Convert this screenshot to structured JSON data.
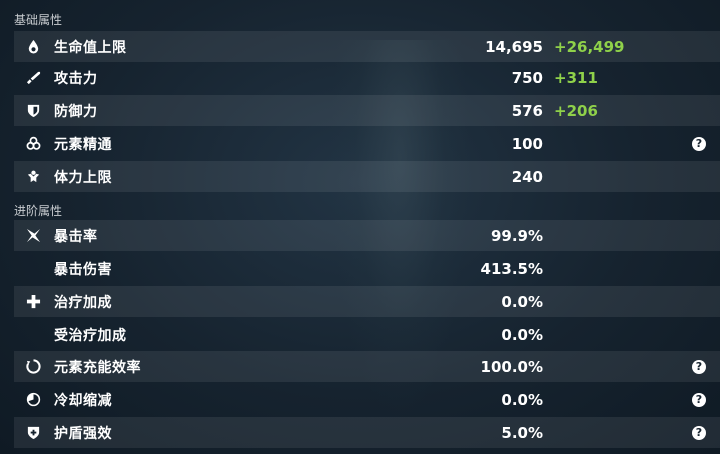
{
  "sections": {
    "basic_title": "基础属性",
    "advanced_title": "进阶属性"
  },
  "basic_stats": [
    {
      "icon": "hp-drop-icon",
      "label": "生命值上限",
      "value": "14,695",
      "bonus": "+26,499",
      "help": false
    },
    {
      "icon": "sword-icon",
      "label": "攻击力",
      "value": "750",
      "bonus": "+311",
      "help": false
    },
    {
      "icon": "shield-icon",
      "label": "防御力",
      "value": "576",
      "bonus": "+206",
      "help": false
    },
    {
      "icon": "elemental-mastery-icon",
      "label": "元素精通",
      "value": "100",
      "bonus": "",
      "help": true
    },
    {
      "icon": "stamina-icon",
      "label": "体力上限",
      "value": "240",
      "bonus": "",
      "help": false
    }
  ],
  "advanced_stats": [
    {
      "icon": "crit-icon",
      "label": "暴击率",
      "value": "99.9%",
      "help": false
    },
    {
      "icon": "",
      "label": "暴击伤害",
      "value": "413.5%",
      "help": false
    },
    {
      "icon": "healing-cross-icon",
      "label": "治疗加成",
      "value": "0.0%",
      "help": false
    },
    {
      "icon": "",
      "label": "受治疗加成",
      "value": "0.0%",
      "help": false
    },
    {
      "icon": "energy-recharge-icon",
      "label": "元素充能效率",
      "value": "100.0%",
      "help": true
    },
    {
      "icon": "cooldown-icon",
      "label": "冷却缩减",
      "value": "0.0%",
      "help": true
    },
    {
      "icon": "shield-strength-icon",
      "label": "护盾强效",
      "value": "5.0%",
      "help": true
    }
  ],
  "help_glyph": "?",
  "colors": {
    "background": "#16232f",
    "bonus_green": "#8fd14a",
    "text": "#ffffff"
  }
}
